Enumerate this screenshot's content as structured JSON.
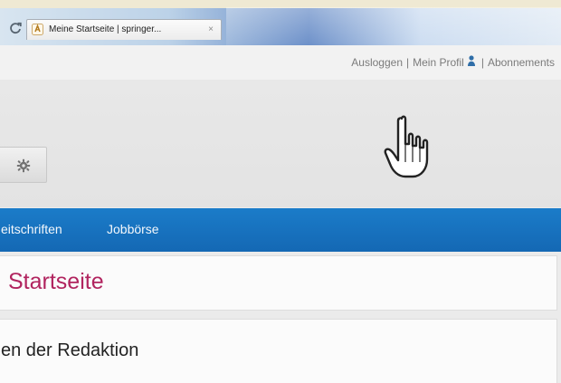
{
  "browser": {
    "tab_title": "Meine Startseite | springer...",
    "tab_close": "×"
  },
  "utility_nav": {
    "logout_label": "Ausloggen",
    "separator_1": "|",
    "profile_label": "Mein Profil",
    "separator_2": "|",
    "subscriptions_label": "Abonnements"
  },
  "main_nav": {
    "items": [
      {
        "label": "eitschriften"
      },
      {
        "label": "Jobbörse"
      }
    ]
  },
  "page": {
    "title": "Startseite"
  },
  "content": {
    "section_title": "en der Redaktion"
  },
  "icons": {
    "refresh": "refresh-icon",
    "favicon": "favicon-icon",
    "user": "user-icon",
    "gear": "gear-icon",
    "cursor": "hand-cursor-icon"
  },
  "colors": {
    "nav_blue": "#1b7cc9",
    "title_magenta": "#b1245f",
    "header_gray": "#e6e6e6",
    "link_gray": "#7b7b7b"
  }
}
